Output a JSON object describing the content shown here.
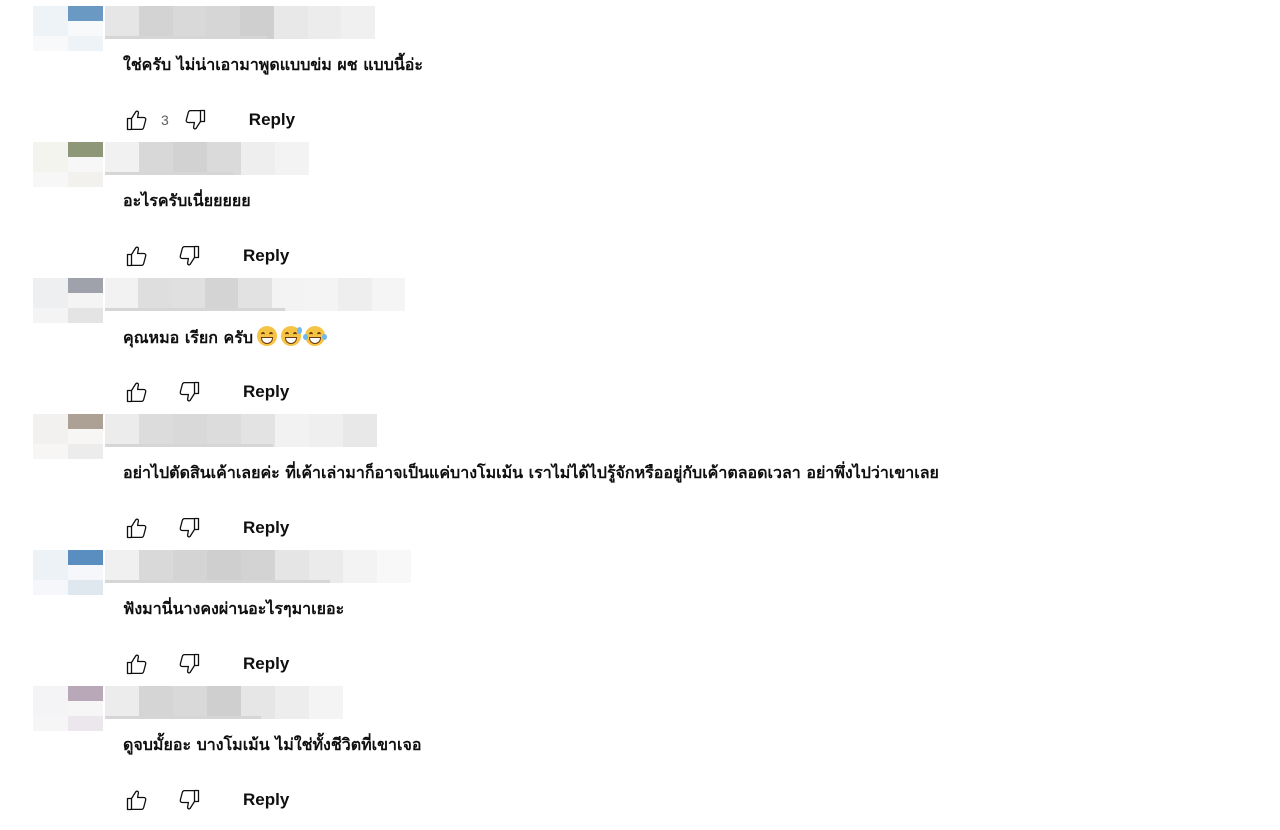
{
  "comments": [
    {
      "text": "ใช่ครับ ไม่น่าเอามาพูดแบบข่ม ผช แบบนี้อ่ะ",
      "like_count": "3",
      "reply_label": "Reply",
      "avatar_colors": [
        "#eef3f7",
        "#6a9ac4",
        "#f7f9fb",
        "#eef3f7"
      ],
      "name_blur_colors": [
        "#e6e6e6",
        "#d3d3d3",
        "#d9d9d9",
        "#d6d6d6",
        "#cfcfcf",
        "#e8e8e8",
        "#ececec",
        "#f0f0f0"
      ]
    },
    {
      "text": "อะไรครับเนี่ยยยยย",
      "like_count": "",
      "reply_label": "Reply",
      "avatar_colors": [
        "#f3f4ee",
        "#8e9878",
        "#f7f7f7",
        "#f2f1ee"
      ],
      "name_blur_colors": [
        "#f1f1f1",
        "#d8d8d8",
        "#d2d2d2",
        "#dadada",
        "#eeeeee",
        "#f3f3f3"
      ]
    },
    {
      "text": "คุณหมอ เรียก ครับ",
      "emojis": [
        "grinning-face-emoji",
        "sweat-smile-emoji",
        "tears-of-joy-emoji"
      ],
      "like_count": "",
      "reply_label": "Reply",
      "avatar_colors": [
        "#eeeff1",
        "#9fa2aa",
        "#f4f4f5",
        "#e4e4e4"
      ],
      "name_blur_colors": [
        "#f2f2f2",
        "#dedede",
        "#e0e0e0",
        "#d4d4d4",
        "#e2e2e2",
        "#f3f3f3",
        "#f4f4f4",
        "#eeeeee",
        "#f5f5f5"
      ]
    },
    {
      "text": "อย่าไปตัดสินเค้าเลยค่ะ ที่เค้าเล่ามาก็อาจเป็นแค่บางโมเม้น เราไม่ได้ไปรู้จักหรืออยู่กับเค้าตลอดเวลา อย่าพึ่งไปว่าเขาเลย",
      "like_count": "",
      "reply_label": "Reply",
      "avatar_colors": [
        "#f3f1ef",
        "#ada095",
        "#f7f6f5",
        "#ececec"
      ],
      "name_blur_colors": [
        "#ececec",
        "#dcdcdc",
        "#d9d9d9",
        "#dcdcdc",
        "#e3e3e3",
        "#f2f2f2",
        "#efefef",
        "#e8e8e8"
      ]
    },
    {
      "text": "ฟังมานี่นางคงผ่านอะไรๆมาเยอะ",
      "like_count": "",
      "reply_label": "Reply",
      "avatar_colors": [
        "#edf2f7",
        "#5a8ec0",
        "#f5f7fa",
        "#dfe7ef"
      ],
      "name_blur_colors": [
        "#f0f0f0",
        "#d9d9d9",
        "#d4d4d4",
        "#cfcfcf",
        "#d3d3d3",
        "#e5e5e5",
        "#ebebeb",
        "#f3f3f3",
        "#f8f8f8"
      ]
    },
    {
      "text": "ดูจบมั้ยอะ บางโมเม้น ไม่ใช่ทั้งชีวิตที่เขาเจอ",
      "like_count": "",
      "reply_label": "Reply",
      "avatar_colors": [
        "#f4f3f5",
        "#b9a9b8",
        "#f7f6f7",
        "#ebe7ec"
      ],
      "name_blur_colors": [
        "#ececec",
        "#d5d5d5",
        "#d9d9d9",
        "#cfcfcf",
        "#e6e6e6",
        "#ededed",
        "#f4f4f4"
      ]
    }
  ],
  "icons": {
    "like": "thumbs-up-outline-icon",
    "dislike": "thumbs-down-outline-icon"
  }
}
